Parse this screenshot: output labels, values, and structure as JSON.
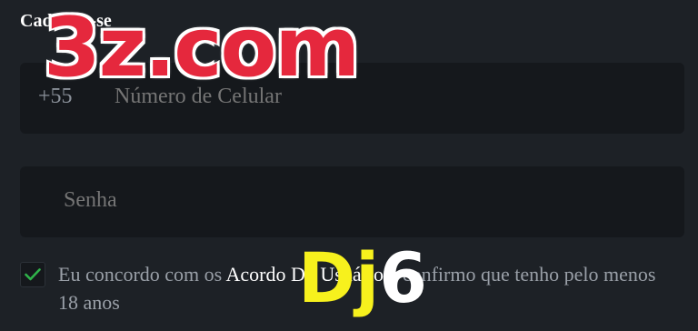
{
  "form": {
    "title": "Cadastre-se",
    "phone": {
      "prefix": "+55",
      "placeholder": "Número de Celular"
    },
    "password": {
      "placeholder": "Senha"
    },
    "agreement": {
      "checked": true,
      "text_before": "Eu concordo com os ",
      "link_label": "Acordo Do Usuário",
      "text_after": " e confirmo que tenho pelo menos 18 anos"
    }
  },
  "overlays": {
    "brand_text": "3z.com",
    "code_part1": "Dj",
    "code_part2": "6"
  },
  "colors": {
    "background": "#1d2126",
    "field_bg": "#15181c",
    "check_green": "#2fb34a",
    "brand_red": "#e5283d",
    "code_yellow": "#f7f11d"
  },
  "icons": {
    "checkbox": "check-icon"
  }
}
